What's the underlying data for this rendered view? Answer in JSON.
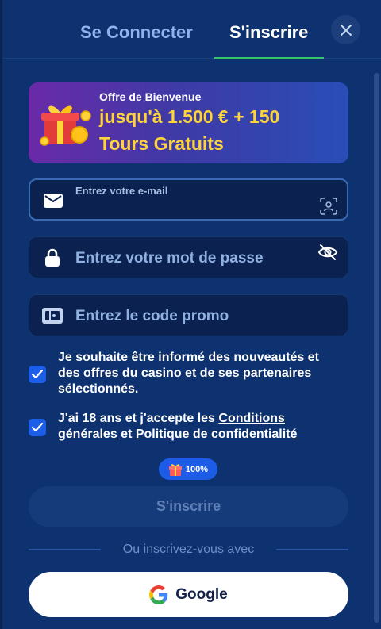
{
  "tabs": {
    "login_label": "Se Connecter",
    "signup_label": "S'inscrire"
  },
  "banner": {
    "pretitle": "Offre de Bienvenue",
    "line1": "jusqu'à 1.500 € + 150",
    "line2": "Tours Gratuits"
  },
  "form": {
    "email": {
      "label": "Entrez votre e-mail",
      "value": "",
      "placeholder": ""
    },
    "password": {
      "placeholder": "Entrez votre mot de passe",
      "value": ""
    },
    "promo": {
      "placeholder": "Entrez le code promo",
      "value": ""
    }
  },
  "consents": {
    "marketing": {
      "checked": true,
      "text": "Je souhaite être informé des nouveautés et des offres du casino et de ses partenaires sélectionnés."
    },
    "terms": {
      "checked": true,
      "prefix": "J'ai 18 ans et j'accepte les ",
      "link1": "Conditions générales",
      "middle": " et ",
      "link2": "Politique de confidentialité"
    }
  },
  "badge": {
    "value": "100%"
  },
  "submit_label": "S'inscrire",
  "divider_text": "Ou inscrivez-vous avec",
  "google_label": "Google",
  "colors": {
    "background": "#0e3270",
    "accent_tab": "#36c56b",
    "checkbox": "#1c5ee8",
    "banner_highlight": "#ffd43b"
  },
  "icons": [
    "close-icon",
    "gift-icon",
    "envelope-icon",
    "face-scan-icon",
    "lock-icon",
    "eye-off-icon",
    "ticket-icon",
    "check-icon",
    "google-icon"
  ]
}
